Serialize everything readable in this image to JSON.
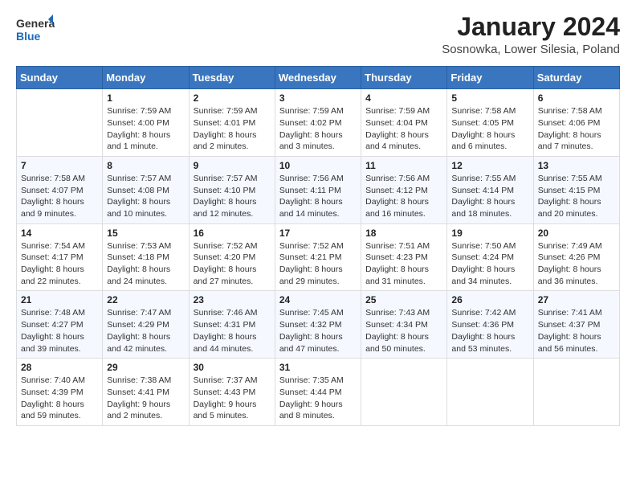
{
  "logo": {
    "general": "General",
    "blue": "Blue"
  },
  "title": "January 2024",
  "location": "Sosnowka, Lower Silesia, Poland",
  "days_of_week": [
    "Sunday",
    "Monday",
    "Tuesday",
    "Wednesday",
    "Thursday",
    "Friday",
    "Saturday"
  ],
  "weeks": [
    [
      {
        "day": "",
        "info": ""
      },
      {
        "day": "1",
        "info": "Sunrise: 7:59 AM\nSunset: 4:00 PM\nDaylight: 8 hours\nand 1 minute."
      },
      {
        "day": "2",
        "info": "Sunrise: 7:59 AM\nSunset: 4:01 PM\nDaylight: 8 hours\nand 2 minutes."
      },
      {
        "day": "3",
        "info": "Sunrise: 7:59 AM\nSunset: 4:02 PM\nDaylight: 8 hours\nand 3 minutes."
      },
      {
        "day": "4",
        "info": "Sunrise: 7:59 AM\nSunset: 4:04 PM\nDaylight: 8 hours\nand 4 minutes."
      },
      {
        "day": "5",
        "info": "Sunrise: 7:58 AM\nSunset: 4:05 PM\nDaylight: 8 hours\nand 6 minutes."
      },
      {
        "day": "6",
        "info": "Sunrise: 7:58 AM\nSunset: 4:06 PM\nDaylight: 8 hours\nand 7 minutes."
      }
    ],
    [
      {
        "day": "7",
        "info": "Sunrise: 7:58 AM\nSunset: 4:07 PM\nDaylight: 8 hours\nand 9 minutes."
      },
      {
        "day": "8",
        "info": "Sunrise: 7:57 AM\nSunset: 4:08 PM\nDaylight: 8 hours\nand 10 minutes."
      },
      {
        "day": "9",
        "info": "Sunrise: 7:57 AM\nSunset: 4:10 PM\nDaylight: 8 hours\nand 12 minutes."
      },
      {
        "day": "10",
        "info": "Sunrise: 7:56 AM\nSunset: 4:11 PM\nDaylight: 8 hours\nand 14 minutes."
      },
      {
        "day": "11",
        "info": "Sunrise: 7:56 AM\nSunset: 4:12 PM\nDaylight: 8 hours\nand 16 minutes."
      },
      {
        "day": "12",
        "info": "Sunrise: 7:55 AM\nSunset: 4:14 PM\nDaylight: 8 hours\nand 18 minutes."
      },
      {
        "day": "13",
        "info": "Sunrise: 7:55 AM\nSunset: 4:15 PM\nDaylight: 8 hours\nand 20 minutes."
      }
    ],
    [
      {
        "day": "14",
        "info": "Sunrise: 7:54 AM\nSunset: 4:17 PM\nDaylight: 8 hours\nand 22 minutes."
      },
      {
        "day": "15",
        "info": "Sunrise: 7:53 AM\nSunset: 4:18 PM\nDaylight: 8 hours\nand 24 minutes."
      },
      {
        "day": "16",
        "info": "Sunrise: 7:52 AM\nSunset: 4:20 PM\nDaylight: 8 hours\nand 27 minutes."
      },
      {
        "day": "17",
        "info": "Sunrise: 7:52 AM\nSunset: 4:21 PM\nDaylight: 8 hours\nand 29 minutes."
      },
      {
        "day": "18",
        "info": "Sunrise: 7:51 AM\nSunset: 4:23 PM\nDaylight: 8 hours\nand 31 minutes."
      },
      {
        "day": "19",
        "info": "Sunrise: 7:50 AM\nSunset: 4:24 PM\nDaylight: 8 hours\nand 34 minutes."
      },
      {
        "day": "20",
        "info": "Sunrise: 7:49 AM\nSunset: 4:26 PM\nDaylight: 8 hours\nand 36 minutes."
      }
    ],
    [
      {
        "day": "21",
        "info": "Sunrise: 7:48 AM\nSunset: 4:27 PM\nDaylight: 8 hours\nand 39 minutes."
      },
      {
        "day": "22",
        "info": "Sunrise: 7:47 AM\nSunset: 4:29 PM\nDaylight: 8 hours\nand 42 minutes."
      },
      {
        "day": "23",
        "info": "Sunrise: 7:46 AM\nSunset: 4:31 PM\nDaylight: 8 hours\nand 44 minutes."
      },
      {
        "day": "24",
        "info": "Sunrise: 7:45 AM\nSunset: 4:32 PM\nDaylight: 8 hours\nand 47 minutes."
      },
      {
        "day": "25",
        "info": "Sunrise: 7:43 AM\nSunset: 4:34 PM\nDaylight: 8 hours\nand 50 minutes."
      },
      {
        "day": "26",
        "info": "Sunrise: 7:42 AM\nSunset: 4:36 PM\nDaylight: 8 hours\nand 53 minutes."
      },
      {
        "day": "27",
        "info": "Sunrise: 7:41 AM\nSunset: 4:37 PM\nDaylight: 8 hours\nand 56 minutes."
      }
    ],
    [
      {
        "day": "28",
        "info": "Sunrise: 7:40 AM\nSunset: 4:39 PM\nDaylight: 8 hours\nand 59 minutes."
      },
      {
        "day": "29",
        "info": "Sunrise: 7:38 AM\nSunset: 4:41 PM\nDaylight: 9 hours\nand 2 minutes."
      },
      {
        "day": "30",
        "info": "Sunrise: 7:37 AM\nSunset: 4:43 PM\nDaylight: 9 hours\nand 5 minutes."
      },
      {
        "day": "31",
        "info": "Sunrise: 7:35 AM\nSunset: 4:44 PM\nDaylight: 9 hours\nand 8 minutes."
      },
      {
        "day": "",
        "info": ""
      },
      {
        "day": "",
        "info": ""
      },
      {
        "day": "",
        "info": ""
      }
    ]
  ]
}
